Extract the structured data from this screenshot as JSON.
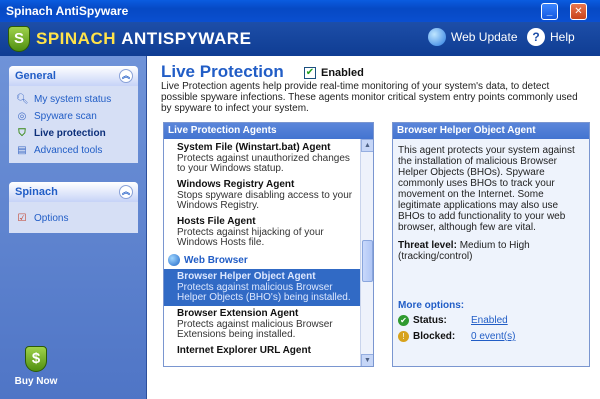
{
  "window": {
    "title": "Spinach AntiSpyware"
  },
  "header": {
    "logo_part1": "SPINACH",
    "logo_part2": "ANTISPYWARE",
    "web_update": "Web Update",
    "help": "Help"
  },
  "sidebar": {
    "general": {
      "title": "General",
      "items": [
        {
          "label": "My system status",
          "icon": "magnifier-icon"
        },
        {
          "label": "Spyware scan",
          "icon": "scan-icon"
        },
        {
          "label": "Live protection",
          "icon": "shield-icon"
        },
        {
          "label": "Advanced tools",
          "icon": "tools-icon"
        }
      ]
    },
    "spinach": {
      "title": "Spinach",
      "items": [
        {
          "label": "Options",
          "icon": "options-icon"
        }
      ]
    },
    "buy_now": "Buy Now"
  },
  "main": {
    "title": "Live Protection",
    "enabled_label": "Enabled",
    "enabled": true,
    "description": "Live Protection agents help provide real-time monitoring of your system's data, to detect possible spyware infections.  These agents monitor critical system entry points commonly used by spyware to infect your system.",
    "agents_header": "Live Protection Agents",
    "agents": [
      {
        "name": "System File (Winstart.bat) Agent",
        "desc": "Protects against unauthorized changes to your Windows statup."
      },
      {
        "name": "Windows Registry Agent",
        "desc": "Stops spyware disabling access to your Windows Registry."
      },
      {
        "name": "Hosts File Agent",
        "desc": "Protects against hijacking of your Windows Hosts file."
      }
    ],
    "section_web_browser": "Web Browser",
    "agents_web": [
      {
        "name": "Browser Helper Object Agent",
        "desc": "Protects against malicious Browser Helper Objects (BHO's) being installed.",
        "selected": true
      },
      {
        "name": "Browser Extension Agent",
        "desc": "Protects against malicious Browser Extensions being installed."
      },
      {
        "name": "Internet Explorer URL Agent",
        "desc": ""
      }
    ],
    "detail": {
      "header": "Browser Helper Object Agent",
      "body": "This agent protects your system against the installation of malicious Browser Helper Objects (BHOs). Spyware commonly uses BHOs to track your movement on the Internet.  Some legitimate applications may also use BHOs to add functionality to your web browser, although few are vital.",
      "threat_label": "Threat level:",
      "threat_value": "Medium to High (tracking/control)",
      "more_options": "More options:",
      "status_label": "Status:",
      "status_value": "Enabled",
      "blocked_label": "Blocked:",
      "blocked_value": "0 event(s)"
    }
  },
  "colors": {
    "accent": "#215dc6",
    "title_bar": "#0a5ce0",
    "selection": "#316ac5"
  }
}
